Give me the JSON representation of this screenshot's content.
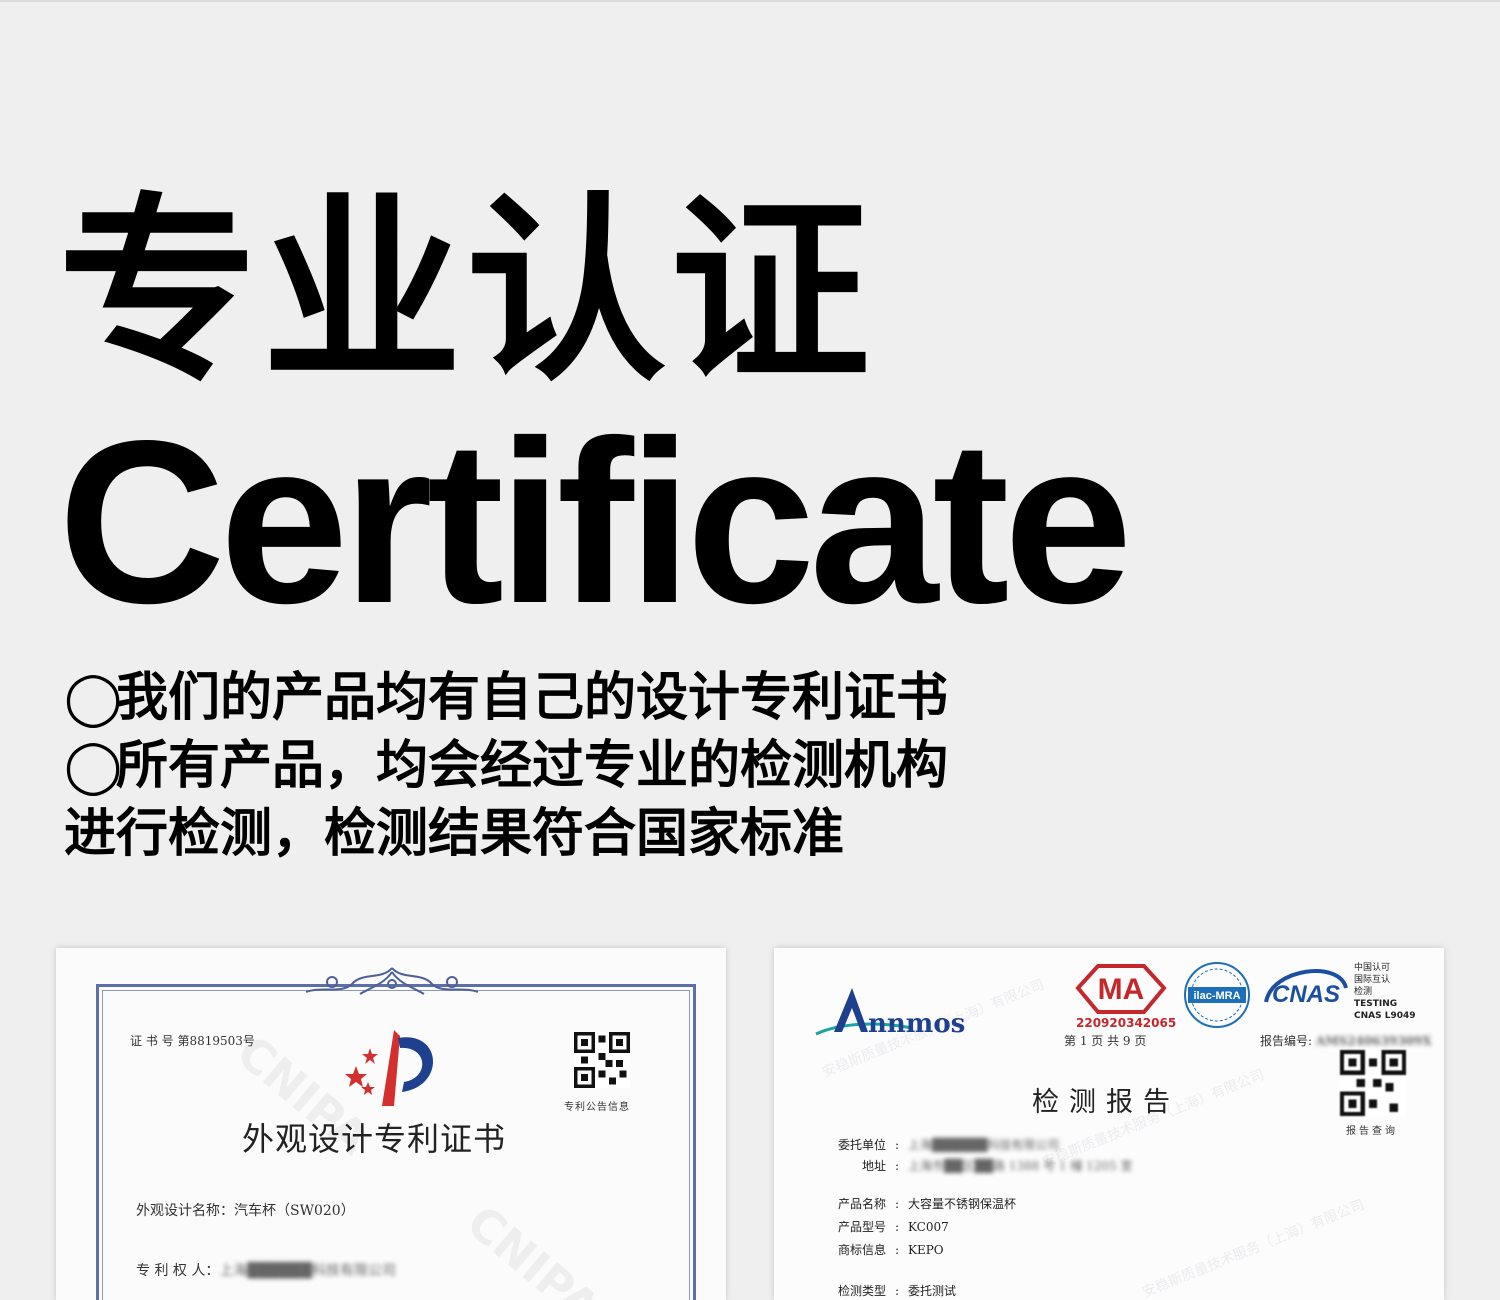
{
  "header": {
    "title_cn": "专业认证",
    "title_en": "Certificate"
  },
  "description": {
    "bullet": "◯",
    "line1": "我们的产品均有自己的设计专利证书",
    "line2": "所有产品，均会经过专业的检测机构",
    "line3": "进行检测，检测结果符合国家标准"
  },
  "patent_certificate": {
    "cert_number": "证 书 号 第8819503号",
    "qr_caption": "专利公告信息",
    "title": "外观设计专利证书",
    "design_name_label": "外观设计名称：",
    "design_name_value": "汽车杯（SW020）",
    "owner_label": "专 利 权 人：",
    "owner_value": "上海██████科技有限公司",
    "watermark": "CNIPA"
  },
  "test_report": {
    "brand": "Annmos",
    "ma_label": "MA",
    "ma_number": "220920342065",
    "ilac_label": "ilac-MRA",
    "cnas_label": "CNAS",
    "cnas_text": [
      "中国认可",
      "国际互认",
      "检测",
      "TESTING",
      "CNAS L9049"
    ],
    "page_info": "第 1 页 共 9 页",
    "report_no_label": "报告编号:",
    "report_no_value": "AMS240639309X",
    "qr_caption": "报告查询",
    "title": "检测报告",
    "fields": [
      {
        "label": "委托单位",
        "value": "上海██████科技有限公司",
        "blurred": true
      },
      {
        "label": "地址",
        "value": "上海市██区██路 1388 号 1 幢 1205 室",
        "blurred": true
      },
      {
        "label": "产品名称",
        "value": "大容量不锈钢保温杯",
        "blurred": false
      },
      {
        "label": "产品型号",
        "value": "KC007",
        "blurred": false
      },
      {
        "label": "商标信息",
        "value": "KEPO",
        "blurred": false
      },
      {
        "label": "检测类型",
        "value": "委托测试",
        "blurred": false
      }
    ],
    "watermark": "安稳斯质量技术服务（上海）有限公司"
  },
  "colors": {
    "background": "#efefef",
    "frame_blue": "#5d6fa6",
    "logo_red": "#d32f2f",
    "logo_blue": "#1f3f8f",
    "ma_red": "#c5282c",
    "cnas_blue": "#1d4fa0"
  }
}
